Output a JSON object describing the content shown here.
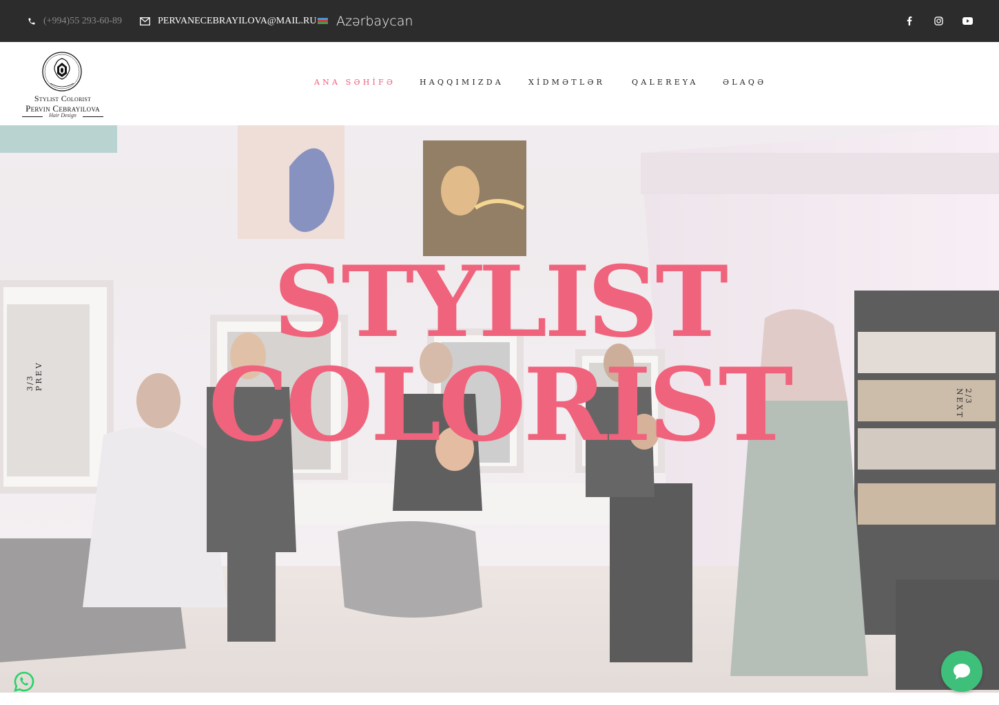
{
  "topbar": {
    "phone": "(+994)55 293-60-89",
    "email": "PERVANECEBRAYILOVA@MAIL.RU",
    "language": "Azərbaycan",
    "social": [
      "facebook-icon",
      "instagram-icon",
      "youtube-icon"
    ]
  },
  "logo": {
    "line1": "Stylist Colorist",
    "line2": "Pervin Cebrayilova",
    "line3": "Hair Design"
  },
  "nav": {
    "items": [
      {
        "label": "ANA SƏHİFƏ",
        "active": true
      },
      {
        "label": "HAQQIMIZDA",
        "active": false
      },
      {
        "label": "XİDMƏTLƏR",
        "active": false
      },
      {
        "label": "QALEREYA",
        "active": false
      },
      {
        "label": "ƏLAQƏ",
        "active": false
      }
    ]
  },
  "hero": {
    "title_line1": "STYLIST",
    "title_line2": "COLORIST",
    "prev_label": "PREV",
    "prev_count": "3/3",
    "next_label": "NEXT",
    "next_count": "2/3"
  },
  "colors": {
    "accent": "#ee5b78",
    "topbar_bg": "#2c2c2c",
    "chat": "#3ec07a",
    "whatsapp": "#25d366"
  }
}
